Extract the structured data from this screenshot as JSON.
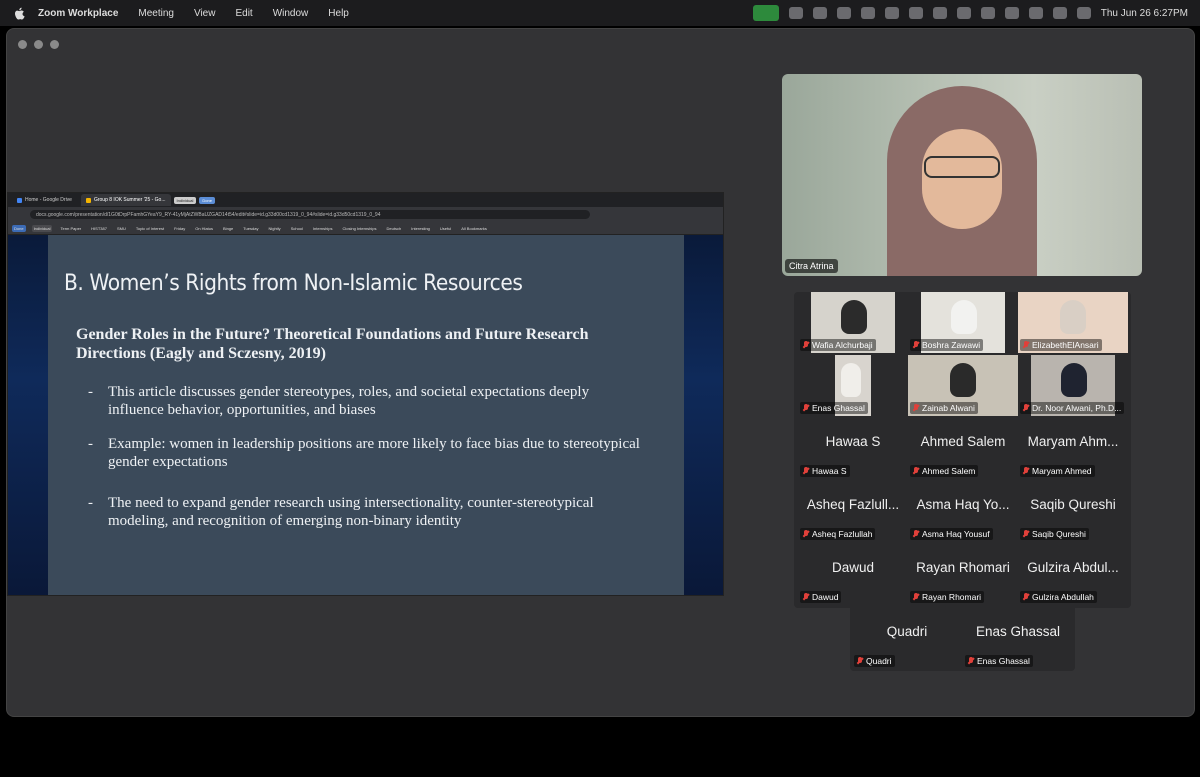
{
  "menubar": {
    "app": "Zoom Workplace",
    "items": [
      "Meeting",
      "View",
      "Edit",
      "Window",
      "Help"
    ],
    "clock": "Thu Jun 26  6:27PM"
  },
  "browser": {
    "tabs": [
      {
        "label": "Home - Google Drive"
      },
      {
        "label": "Group 8 IOK Summer '25 - Go..."
      }
    ],
    "tab_pills": [
      "Individual",
      "Done"
    ],
    "url": "docs.google.com/presentation/d/1G0tDrpPFamhGYeaY9_RY-41yMjAtZWBaUZGAD14t54/edit#slide=id.g33d00cd1319_0_94#slide=id.g33d50cd1319_0_94",
    "bookmarks": [
      "Done",
      "Individual",
      "Term Paper",
      "HIST387",
      "SMU",
      "Topic of Interest",
      "Friday",
      "On Hiatus",
      "Binge",
      "Tuesday",
      "Nightly",
      "School",
      "Internships",
      "Closing Internships",
      "Deutsch",
      "Interesting",
      "Useful",
      "All Bookmarks"
    ]
  },
  "slide": {
    "title": "B. Women’s Rights from Non-Islamic Resources",
    "subtitle": "Gender Roles in the Future? Theoretical Foundations and Future Research Directions (Eagly and Sczesny, 2019)",
    "bullets": [
      "This article discusses gender stereotypes, roles, and societal expectations deeply influence behavior, opportunities, and biases",
      "Example: women in leadership positions are more likely to face bias due to stereotypical gender expectations",
      "The need to expand gender research using intersectionality, counter-stereotypical modeling, and recognition of emerging non-binary identity"
    ],
    "bullet_marker": "-"
  },
  "speaker": {
    "name": "Citra Atrina"
  },
  "participants": [
    {
      "name": "Wafia Alchurbaji",
      "video": true
    },
    {
      "name": "Boshra Zawawi",
      "video": true
    },
    {
      "name": "ElizabethElAnsari",
      "video": true
    },
    {
      "name": "Enas Ghassal",
      "video": true
    },
    {
      "name": "Zainab Alwani",
      "video": true
    },
    {
      "name": "Dr. Noor Alwani, Ph.D...",
      "video": true
    },
    {
      "display": "Hawaa S",
      "name": "Hawaa S",
      "video": false
    },
    {
      "display": "Ahmed Salem",
      "name": "Ahmed Salem",
      "video": false
    },
    {
      "display": "Maryam Ahm...",
      "name": "Maryam Ahmed",
      "video": false
    },
    {
      "display": "Asheq Fazlull...",
      "name": "Asheq Fazlullah",
      "video": false
    },
    {
      "display": "Asma Haq Yo...",
      "name": "Asma Haq Yousuf",
      "video": false
    },
    {
      "display": "Saqib Qureshi",
      "name": "Saqib Qureshi",
      "video": false
    },
    {
      "display": "Dawud",
      "name": "Dawud",
      "video": false
    },
    {
      "display": "Rayan Rhomari",
      "name": "Rayan Rhomari",
      "video": false
    },
    {
      "display": "Gulzira Abdul...",
      "name": "Gulzira Abdullah",
      "video": false
    },
    {
      "display": "Quadri",
      "name": "Quadri",
      "video": false
    },
    {
      "display": "Enas Ghassal",
      "name": "Enas Ghassal",
      "video": false
    }
  ],
  "colors": {
    "muted_mic": "#e0403a",
    "window_bg": "#333335",
    "slide_bg": "#3b4a5a"
  }
}
